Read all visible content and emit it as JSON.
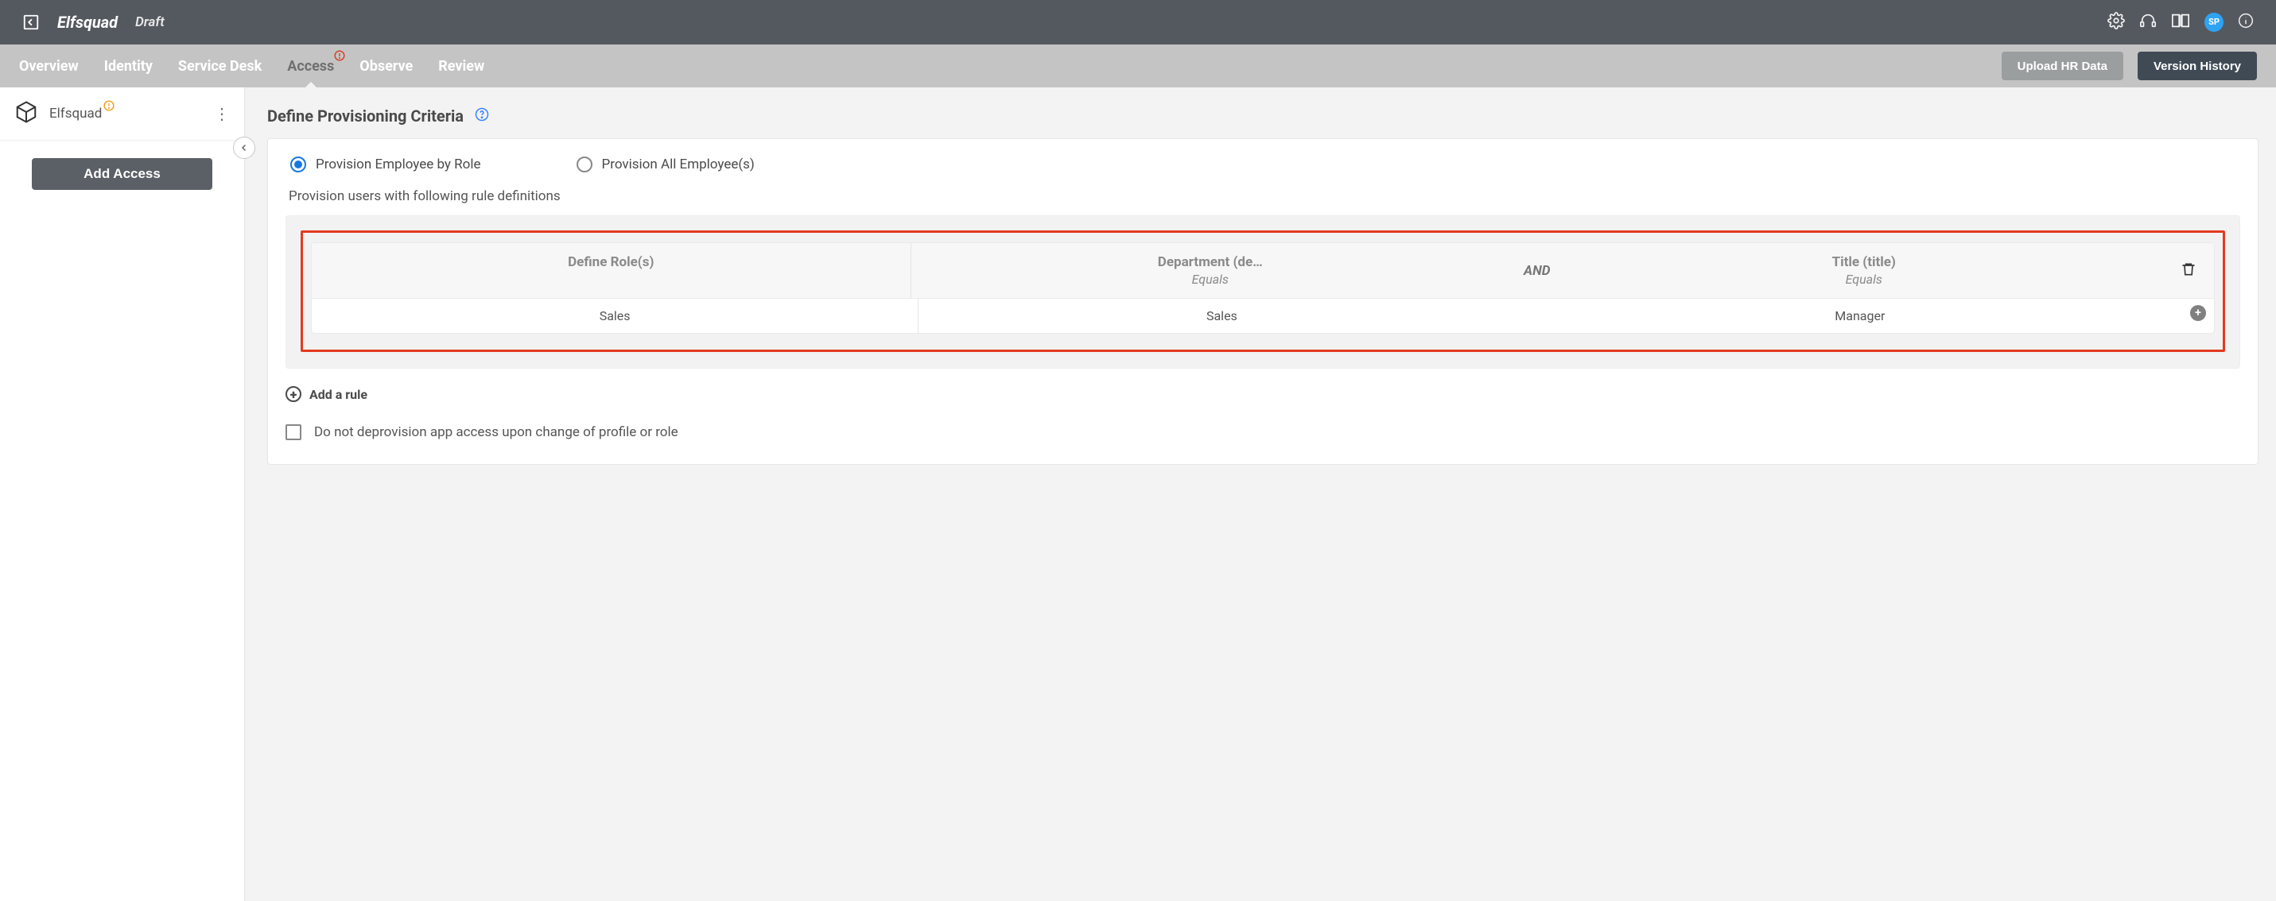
{
  "header": {
    "brand": "Elfsquad",
    "status": "Draft",
    "avatar_initials": "SP"
  },
  "tabs": {
    "items": [
      {
        "label": "Overview"
      },
      {
        "label": "Identity"
      },
      {
        "label": "Service Desk"
      },
      {
        "label": "Access"
      },
      {
        "label": "Observe"
      },
      {
        "label": "Review"
      }
    ],
    "active_index": 3,
    "alert_on_index": 3
  },
  "actions": {
    "upload_label": "Upload HR Data",
    "history_label": "Version History"
  },
  "sidebar": {
    "app_name": "Elfsquad",
    "add_button": "Add Access"
  },
  "section": {
    "title": "Define Provisioning Criteria"
  },
  "provision": {
    "options": {
      "by_role": "Provision Employee by Role",
      "all": "Provision All Employee(s)"
    },
    "selected": "by_role",
    "caption": "Provision users with following rule definitions"
  },
  "rule": {
    "role_header": "Define Role(s)",
    "col1_header": "Department (de…",
    "col1_sub": "Equals",
    "logic": "AND",
    "col2_header": "Title (title)",
    "col2_sub": "Equals",
    "row": {
      "role": "Sales",
      "department": "Sales",
      "title": "Manager"
    }
  },
  "add_rule_label": "Add a rule",
  "checkbox_label": "Do not deprovision app access upon change of profile or role"
}
